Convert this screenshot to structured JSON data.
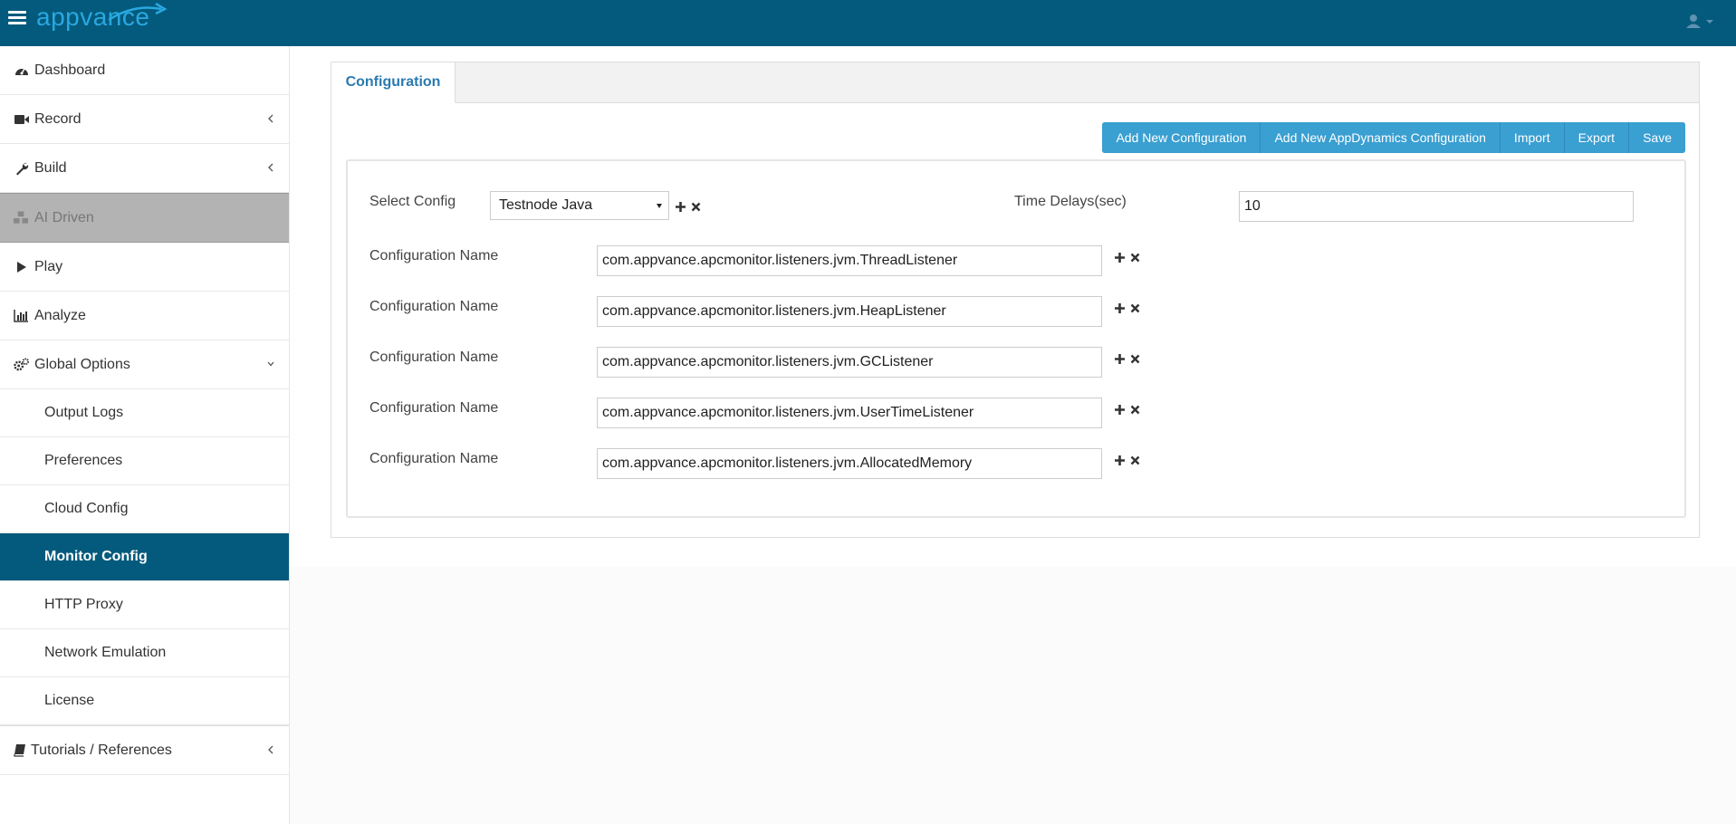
{
  "header": {
    "logo_text": "appvance"
  },
  "sidebar": {
    "items": [
      {
        "label": "Dashboard"
      },
      {
        "label": "Record"
      },
      {
        "label": "Build"
      },
      {
        "label": "AI Driven"
      },
      {
        "label": "Play"
      },
      {
        "label": "Analyze"
      },
      {
        "label": "Global Options"
      }
    ],
    "sub_items": [
      {
        "label": "Output Logs"
      },
      {
        "label": "Preferences"
      },
      {
        "label": "Cloud Config"
      },
      {
        "label": "Monitor Config"
      },
      {
        "label": "HTTP Proxy"
      },
      {
        "label": "Network Emulation"
      },
      {
        "label": "License"
      }
    ],
    "tutorials": {
      "label": "Tutorials / References"
    }
  },
  "main": {
    "tab_label": "Configuration",
    "buttons": {
      "add_new": "Add New Configuration",
      "add_appd": "Add New AppDynamics Configuration",
      "import": "Import",
      "export": "Export",
      "save": "Save"
    },
    "select_config": {
      "label": "Select Config",
      "value": "Testnode Java"
    },
    "time_delays": {
      "label": "Time Delays(sec)",
      "value": "10"
    },
    "configs": [
      {
        "label": "Configuration Name",
        "value": "com.appvance.apcmonitor.listeners.jvm.ThreadListener"
      },
      {
        "label": "Configuration Name",
        "value": "com.appvance.apcmonitor.listeners.jvm.HeapListener"
      },
      {
        "label": "Configuration Name",
        "value": "com.appvance.apcmonitor.listeners.jvm.GCListener"
      },
      {
        "label": "Configuration Name",
        "value": "com.appvance.apcmonitor.listeners.jvm.UserTimeListener"
      },
      {
        "label": "Configuration Name",
        "value": "com.appvance.apcmonitor.listeners.jvm.AllocatedMemory"
      }
    ]
  },
  "colors": {
    "header_bg": "#045a7c",
    "accent": "#3a9fd1",
    "active_nav": "#045a7c"
  }
}
